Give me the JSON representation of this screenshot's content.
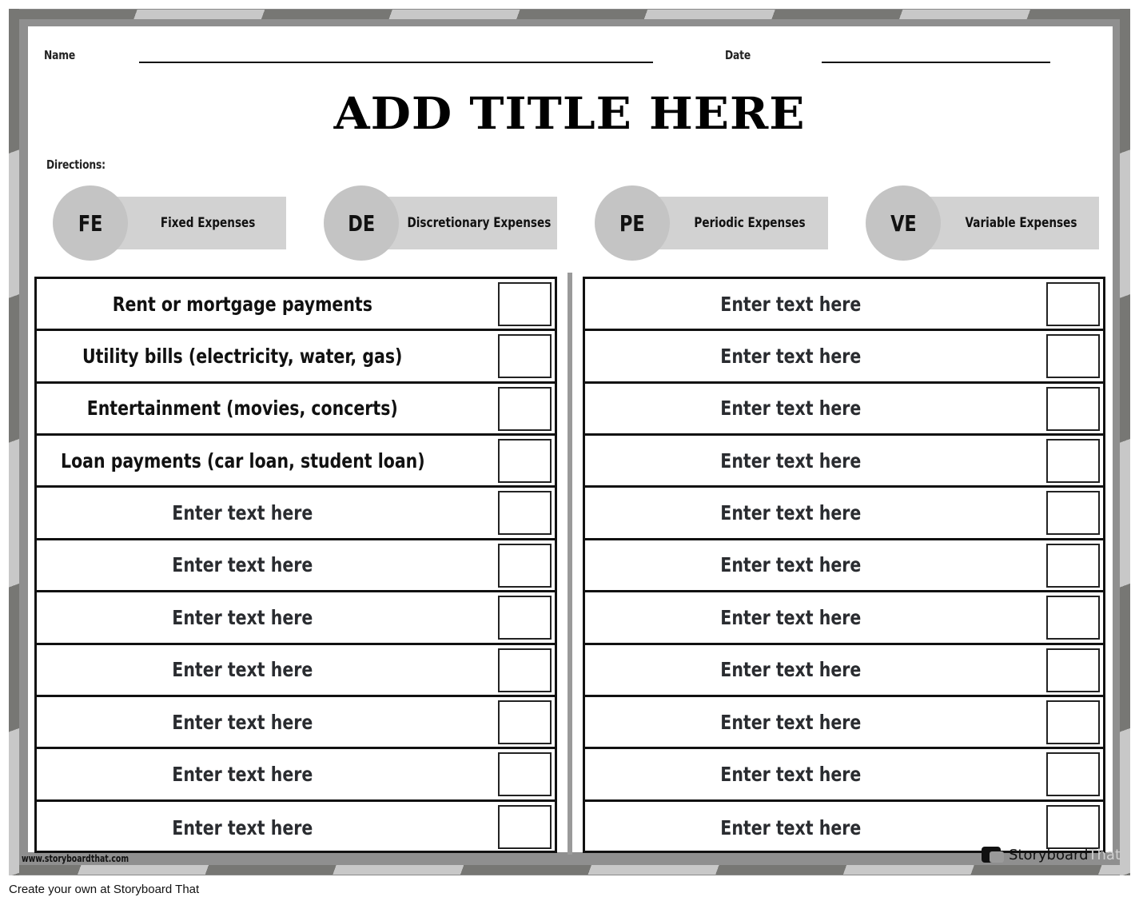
{
  "header": {
    "name_label": "Name",
    "date_label": "Date",
    "title": "ADD TITLE HERE",
    "directions_label": "Directions:"
  },
  "legend": [
    {
      "abbr": "FE",
      "name": "Fixed Expenses"
    },
    {
      "abbr": "DE",
      "name": "Discretionary Expenses"
    },
    {
      "abbr": "PE",
      "name": "Periodic Expenses"
    },
    {
      "abbr": "VE",
      "name": "Variable Expenses"
    }
  ],
  "left_table": {
    "rows": [
      "Rent or mortgage payments",
      "Utility bills (electricity, water, gas)",
      "Entertainment (movies, concerts)",
      "Loan payments (car loan, student loan)",
      "Enter text here",
      "Enter text here",
      "Enter text here",
      "Enter text here",
      "Enter text here",
      "Enter text here",
      "Enter text here"
    ]
  },
  "right_table": {
    "rows": [
      "Enter text here",
      "Enter text here",
      "Enter text here",
      "Enter text here",
      "Enter text here",
      "Enter text here",
      "Enter text here",
      "Enter text here",
      "Enter text here",
      "Enter text here",
      "Enter text here"
    ]
  },
  "watermark": {
    "url": "www.storyboardthat.com",
    "brand_part1": "Storyboard",
    "brand_part2": "That"
  },
  "footer": {
    "text": "Create your own at Storyboard That"
  },
  "colors": {
    "stripe_dark": "#777774",
    "stripe_light": "#c8c8c8",
    "legend_circle": "#c4c4c4",
    "legend_bar": "#d2d2d2"
  }
}
